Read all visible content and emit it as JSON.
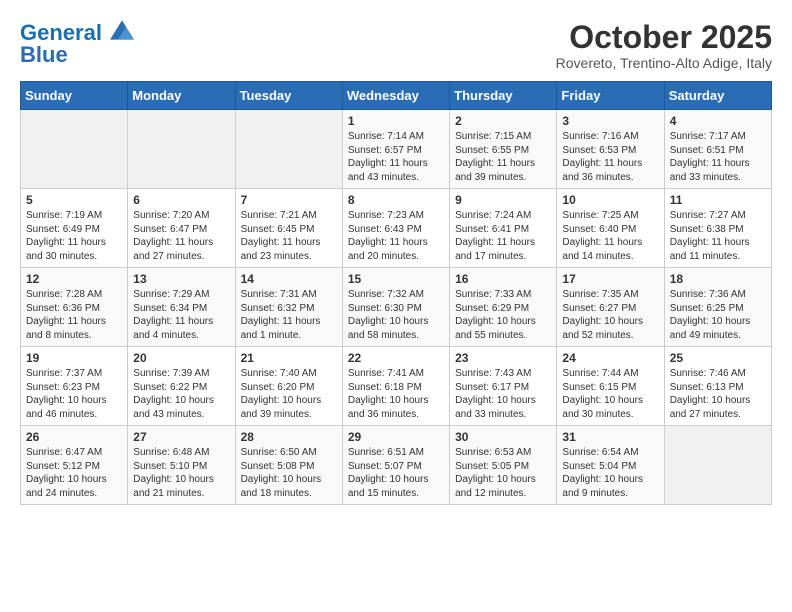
{
  "header": {
    "logo_line1": "General",
    "logo_line2": "Blue",
    "month": "October 2025",
    "location": "Rovereto, Trentino-Alto Adige, Italy"
  },
  "days_of_week": [
    "Sunday",
    "Monday",
    "Tuesday",
    "Wednesday",
    "Thursday",
    "Friday",
    "Saturday"
  ],
  "weeks": [
    [
      {
        "day": "",
        "content": ""
      },
      {
        "day": "",
        "content": ""
      },
      {
        "day": "",
        "content": ""
      },
      {
        "day": "1",
        "content": "Sunrise: 7:14 AM\nSunset: 6:57 PM\nDaylight: 11 hours and 43 minutes."
      },
      {
        "day": "2",
        "content": "Sunrise: 7:15 AM\nSunset: 6:55 PM\nDaylight: 11 hours and 39 minutes."
      },
      {
        "day": "3",
        "content": "Sunrise: 7:16 AM\nSunset: 6:53 PM\nDaylight: 11 hours and 36 minutes."
      },
      {
        "day": "4",
        "content": "Sunrise: 7:17 AM\nSunset: 6:51 PM\nDaylight: 11 hours and 33 minutes."
      }
    ],
    [
      {
        "day": "5",
        "content": "Sunrise: 7:19 AM\nSunset: 6:49 PM\nDaylight: 11 hours and 30 minutes."
      },
      {
        "day": "6",
        "content": "Sunrise: 7:20 AM\nSunset: 6:47 PM\nDaylight: 11 hours and 27 minutes."
      },
      {
        "day": "7",
        "content": "Sunrise: 7:21 AM\nSunset: 6:45 PM\nDaylight: 11 hours and 23 minutes."
      },
      {
        "day": "8",
        "content": "Sunrise: 7:23 AM\nSunset: 6:43 PM\nDaylight: 11 hours and 20 minutes."
      },
      {
        "day": "9",
        "content": "Sunrise: 7:24 AM\nSunset: 6:41 PM\nDaylight: 11 hours and 17 minutes."
      },
      {
        "day": "10",
        "content": "Sunrise: 7:25 AM\nSunset: 6:40 PM\nDaylight: 11 hours and 14 minutes."
      },
      {
        "day": "11",
        "content": "Sunrise: 7:27 AM\nSunset: 6:38 PM\nDaylight: 11 hours and 11 minutes."
      }
    ],
    [
      {
        "day": "12",
        "content": "Sunrise: 7:28 AM\nSunset: 6:36 PM\nDaylight: 11 hours and 8 minutes."
      },
      {
        "day": "13",
        "content": "Sunrise: 7:29 AM\nSunset: 6:34 PM\nDaylight: 11 hours and 4 minutes."
      },
      {
        "day": "14",
        "content": "Sunrise: 7:31 AM\nSunset: 6:32 PM\nDaylight: 11 hours and 1 minute."
      },
      {
        "day": "15",
        "content": "Sunrise: 7:32 AM\nSunset: 6:30 PM\nDaylight: 10 hours and 58 minutes."
      },
      {
        "day": "16",
        "content": "Sunrise: 7:33 AM\nSunset: 6:29 PM\nDaylight: 10 hours and 55 minutes."
      },
      {
        "day": "17",
        "content": "Sunrise: 7:35 AM\nSunset: 6:27 PM\nDaylight: 10 hours and 52 minutes."
      },
      {
        "day": "18",
        "content": "Sunrise: 7:36 AM\nSunset: 6:25 PM\nDaylight: 10 hours and 49 minutes."
      }
    ],
    [
      {
        "day": "19",
        "content": "Sunrise: 7:37 AM\nSunset: 6:23 PM\nDaylight: 10 hours and 46 minutes."
      },
      {
        "day": "20",
        "content": "Sunrise: 7:39 AM\nSunset: 6:22 PM\nDaylight: 10 hours and 43 minutes."
      },
      {
        "day": "21",
        "content": "Sunrise: 7:40 AM\nSunset: 6:20 PM\nDaylight: 10 hours and 39 minutes."
      },
      {
        "day": "22",
        "content": "Sunrise: 7:41 AM\nSunset: 6:18 PM\nDaylight: 10 hours and 36 minutes."
      },
      {
        "day": "23",
        "content": "Sunrise: 7:43 AM\nSunset: 6:17 PM\nDaylight: 10 hours and 33 minutes."
      },
      {
        "day": "24",
        "content": "Sunrise: 7:44 AM\nSunset: 6:15 PM\nDaylight: 10 hours and 30 minutes."
      },
      {
        "day": "25",
        "content": "Sunrise: 7:46 AM\nSunset: 6:13 PM\nDaylight: 10 hours and 27 minutes."
      }
    ],
    [
      {
        "day": "26",
        "content": "Sunrise: 6:47 AM\nSunset: 5:12 PM\nDaylight: 10 hours and 24 minutes."
      },
      {
        "day": "27",
        "content": "Sunrise: 6:48 AM\nSunset: 5:10 PM\nDaylight: 10 hours and 21 minutes."
      },
      {
        "day": "28",
        "content": "Sunrise: 6:50 AM\nSunset: 5:08 PM\nDaylight: 10 hours and 18 minutes."
      },
      {
        "day": "29",
        "content": "Sunrise: 6:51 AM\nSunset: 5:07 PM\nDaylight: 10 hours and 15 minutes."
      },
      {
        "day": "30",
        "content": "Sunrise: 6:53 AM\nSunset: 5:05 PM\nDaylight: 10 hours and 12 minutes."
      },
      {
        "day": "31",
        "content": "Sunrise: 6:54 AM\nSunset: 5:04 PM\nDaylight: 10 hours and 9 minutes."
      },
      {
        "day": "",
        "content": ""
      }
    ]
  ]
}
